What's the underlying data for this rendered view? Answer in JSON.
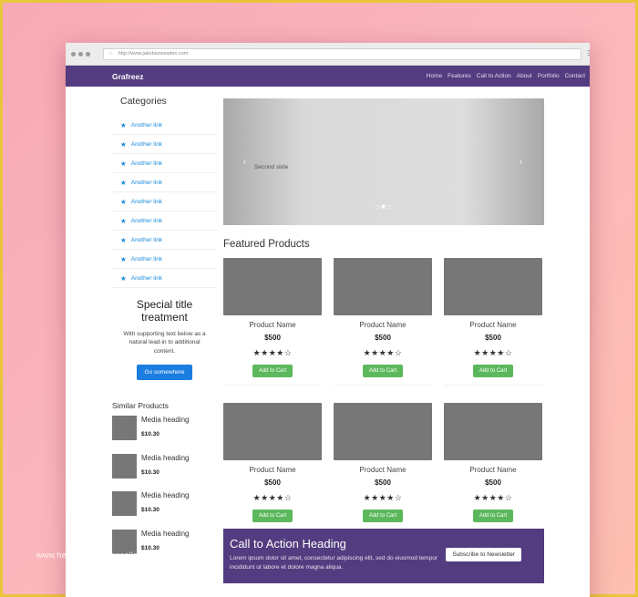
{
  "browser": {
    "url": "http://www.jakobaswesden.com"
  },
  "navbar": {
    "brand": "Grafreez",
    "links": [
      "Home",
      "Features",
      "Call to Action",
      "About",
      "Portfolio",
      "Contact"
    ]
  },
  "sidebar": {
    "categories_title": "Categories",
    "links": [
      "Another link",
      "Another link",
      "Another link",
      "Another link",
      "Another link",
      "Another link",
      "Another link",
      "Another link",
      "Another link"
    ],
    "special": {
      "title": "Special title treatment",
      "text": "With supporting text below as a natural lead-in to additional content.",
      "button": "Go somewhere"
    },
    "similar_title": "Similar Products",
    "media": [
      {
        "heading": "Media heading",
        "price": "$10.30"
      },
      {
        "heading": "Media heading",
        "price": "$10.30"
      },
      {
        "heading": "Media heading",
        "price": "$10.30"
      },
      {
        "heading": "Media heading",
        "price": "$10.30"
      }
    ]
  },
  "carousel": {
    "caption": "Second slide",
    "prev": "‹",
    "next": "›",
    "slides": 3,
    "active_slide": 2
  },
  "featured": {
    "title": "Featured Products",
    "products": [
      {
        "name": "Product Name",
        "price": "$500",
        "stars": "★★★★☆",
        "button": "Add to Cart"
      },
      {
        "name": "Product Name",
        "price": "$500",
        "stars": "★★★★☆",
        "button": "Add to Cart"
      },
      {
        "name": "Product Name",
        "price": "$500",
        "stars": "★★★★☆",
        "button": "Add to Cart"
      },
      {
        "name": "Product Name",
        "price": "$500",
        "stars": "★★★★☆",
        "button": "Add to Cart"
      },
      {
        "name": "Product Name",
        "price": "$500",
        "stars": "★★★★☆",
        "button": "Add to Cart"
      },
      {
        "name": "Product Name",
        "price": "$500",
        "stars": "★★★★☆",
        "button": "Add to Cart"
      }
    ]
  },
  "cta": {
    "heading": "Call to Action Heading",
    "text": "Lorem ipsum dolor sit amet, consectetur adipiscing elit, sed do eiusmod tempor incididunt ut labore et dolore magna aliqua.",
    "button": "Subscribe to Newsletter"
  },
  "watermark": "www.heritagechristiancollege.com",
  "colors": {
    "nav_purple": "#533c7f",
    "link_blue": "#1a8adb",
    "primary_button": "#1a7de0",
    "success_button": "#5cb85c",
    "frame_border": "#e9c53a"
  }
}
